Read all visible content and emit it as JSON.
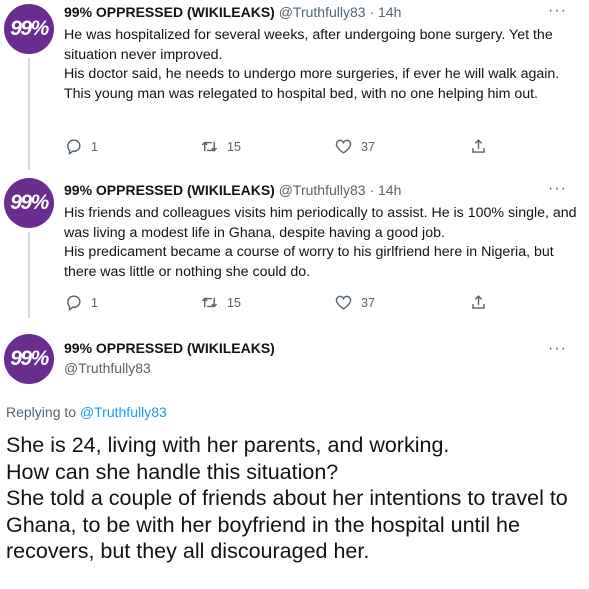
{
  "tweets": [
    {
      "avatar_text": "99%",
      "name": "99% OPPRESSED (WIKILEAKS)",
      "handle": "@Truthfully83",
      "time": "14h",
      "more": "···",
      "lines": [
        "He was hospitalized for several weeks, after undergoing bone surgery. Yet the situation never improved.",
        "His doctor said, he needs to undergo more surgeries, if ever he will walk again.",
        "This young man was relegated to hospital bed, with no one helping him out."
      ],
      "replies": "1",
      "retweets": "15",
      "likes": "37"
    },
    {
      "avatar_text": "99%",
      "name": "99% OPPRESSED (WIKILEAKS)",
      "handle": "@Truthfully83",
      "time": "14h",
      "more": "···",
      "lines": [
        "His friends and colleagues visits him periodically to assist. He is 100% single, and was living a modest life in Ghana, despite having a good job.",
        "His predicament became a course of worry to his girlfriend here in Nigeria, but there was little or nothing she could do."
      ],
      "replies": "1",
      "retweets": "15",
      "likes": "37"
    }
  ],
  "main_tweet": {
    "avatar_text": "99%",
    "name": "99% OPPRESSED (WIKILEAKS)",
    "handle": "@Truthfully83",
    "more": "···",
    "replying_prefix": "Replying to",
    "replying_to": "@Truthfully83",
    "lines": [
      "She is 24, living with her parents, and working.",
      "How can she handle this situation?",
      "She told a couple of friends about her intentions to travel to Ghana, to be with her boyfriend in the hospital until he recovers, but they all discouraged her."
    ]
  },
  "colors": {
    "avatar_bg": "#6a2c91",
    "link": "#1d9bf0",
    "muted": "#536471",
    "thread_line": "#cfd9de"
  },
  "icons": [
    "reply-icon",
    "retweet-icon",
    "like-icon",
    "share-icon",
    "more-icon"
  ]
}
